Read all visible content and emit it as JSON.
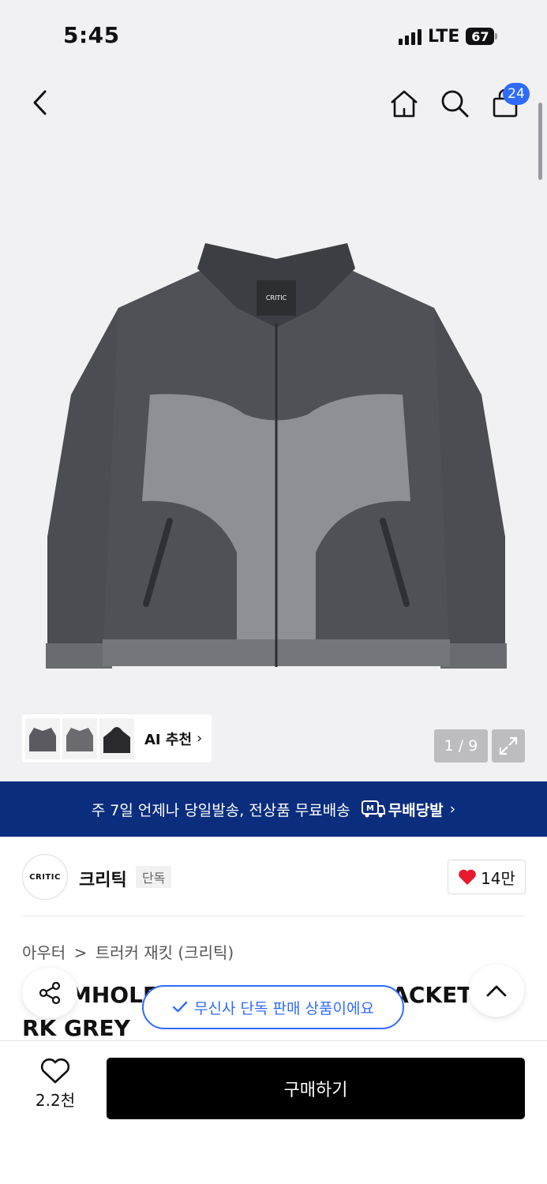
{
  "status": {
    "time": "5:45",
    "network": "LTE",
    "battery": "67"
  },
  "nav": {
    "cart_count": "24"
  },
  "gallery": {
    "ai_label": "AI 추천",
    "page_indicator": "1 / 9",
    "product_logo_text": "CRITIC"
  },
  "banner": {
    "text": "주 7일 언제나 당일발송, 전상품 무료배송",
    "badge": "무배당발",
    "badge_icon": "M"
  },
  "brand": {
    "logo_text": "CRITIC",
    "name": "크리틱",
    "tag": "단독",
    "likes": "14만"
  },
  "breadcrumb": {
    "category": "아우터",
    "separator": ">",
    "subcategory": "트러커 재킷 (크리틱)"
  },
  "product": {
    "title_line1": "MHOLE LOGO TWO TONE JACKET",
    "title_line2": "RK GREY"
  },
  "toast": {
    "text": "무신사 단독 판매 상품이에요"
  },
  "bottom": {
    "wish_count": "2.2천",
    "buy_label": "구매하기"
  },
  "colors": {
    "accent_blue": "#2f6bff",
    "banner_navy": "#0a2d7e",
    "heart_red": "#e8192c"
  }
}
